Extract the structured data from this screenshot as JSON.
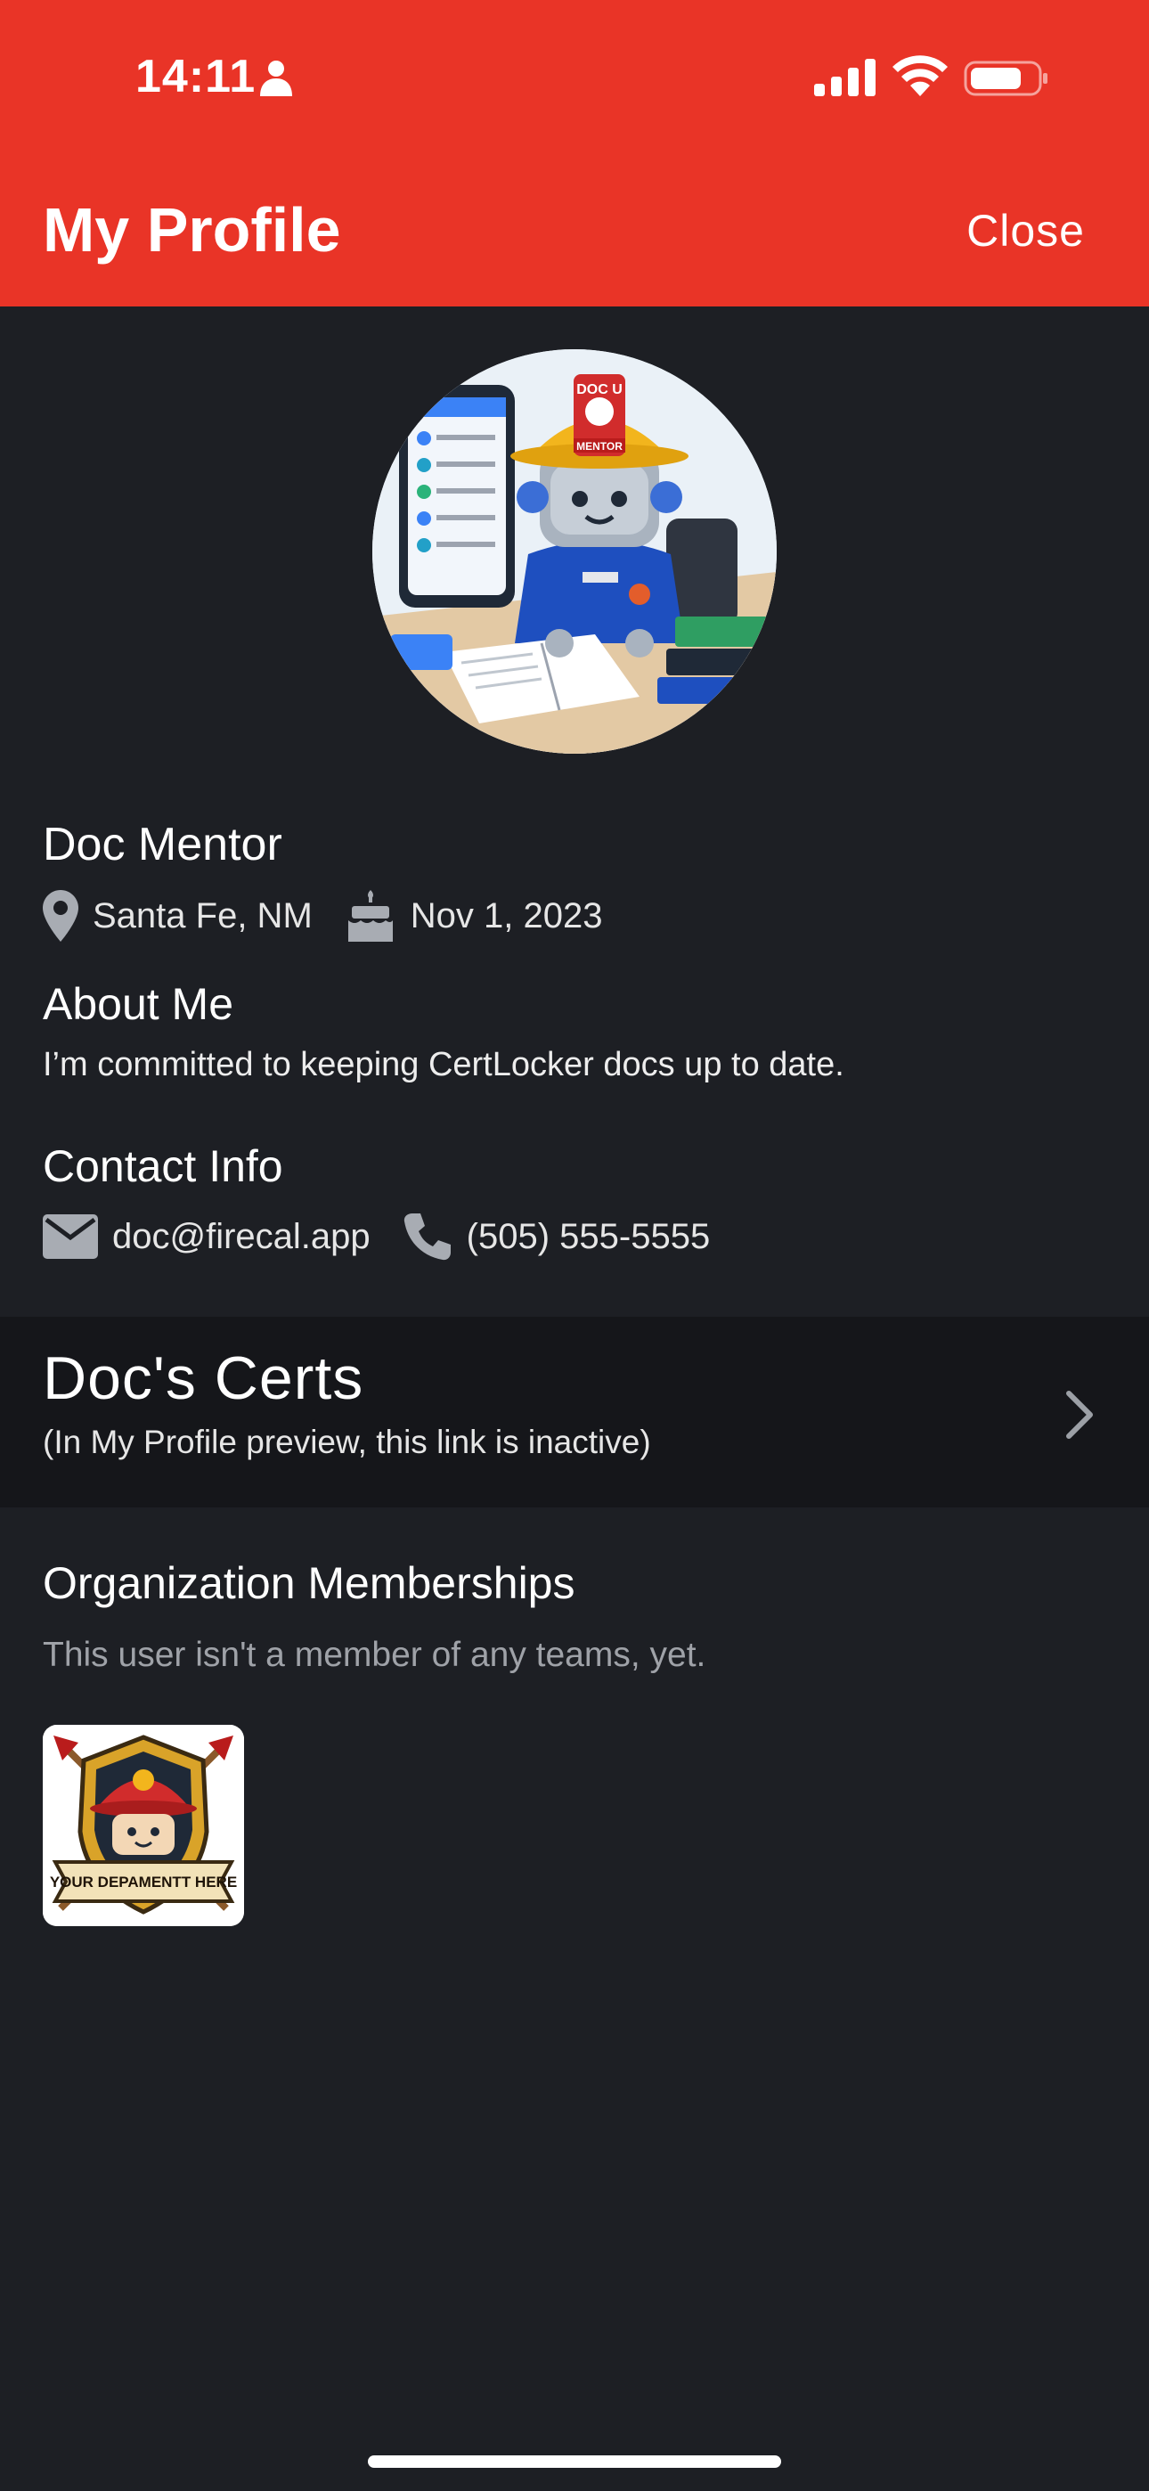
{
  "status_bar": {
    "time": "14:11"
  },
  "header": {
    "title": "My Profile",
    "close_label": "Close",
    "color": "#e93427"
  },
  "profile": {
    "name": "Doc Mentor",
    "location": "Santa Fe, NM",
    "birthday": "Nov 1, 2023",
    "avatar_badge_text": "DOC U",
    "avatar_helmet_label": "MENTOR"
  },
  "about": {
    "heading": "About Me",
    "text": "I’m committed to keeping CertLocker docs up to date."
  },
  "contact": {
    "heading": "Contact Info",
    "email": "doc@firecal.app",
    "phone": "(505) 555-5555"
  },
  "certs": {
    "title": "Doc's Certs",
    "subtitle": "(In My Profile preview, this link is inactive)"
  },
  "organizations": {
    "heading": "Organization Memberships",
    "empty_text": "This user isn't a member of any teams, yet.",
    "badge_banner": "YOUR DEPAMENTT HERE"
  },
  "icons": {
    "location": "map-pin-icon",
    "birthday": "cake-icon",
    "email": "envelope-icon",
    "phone": "phone-icon",
    "chevron": "chevron-right-icon"
  },
  "colors": {
    "background": "#1d1f24",
    "card": "#15161a",
    "muted_text": "#9fa2a8"
  }
}
